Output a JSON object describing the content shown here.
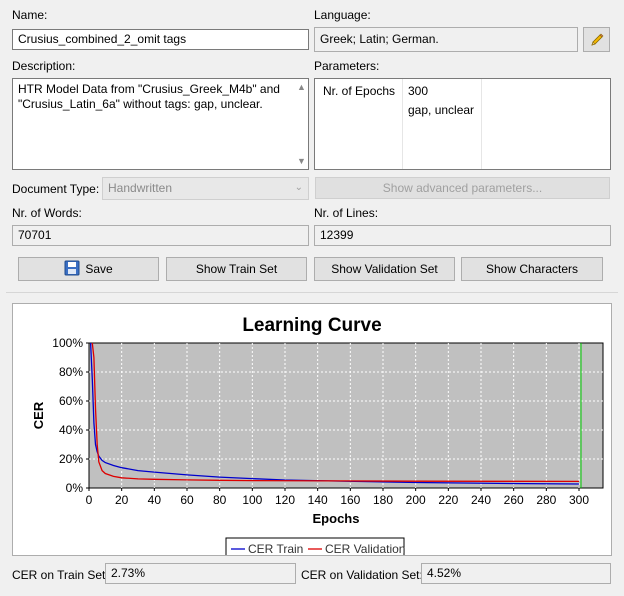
{
  "form": {
    "name_label": "Name:",
    "name_value": "Crusius_combined_2_omit tags",
    "language_label": "Language:",
    "language_value": "Greek; Latin; German.",
    "description_label": "Description:",
    "description_value": "HTR Model Data from \"Crusius_Greek_M4b\" and \"Crusius_Latin_6a\" without tags: gap, unclear.",
    "parameters_label": "Parameters:",
    "param_name": "Nr. of Epochs",
    "param_value_1": "300",
    "param_value_2": "gap, unclear",
    "doc_type_label": "Document Type:",
    "doc_type_value": "Handwritten",
    "advanced_button": "Show advanced parameters...",
    "words_label": "Nr. of Words:",
    "words_value": "70701",
    "lines_label": "Nr. of Lines:",
    "lines_value": "12399"
  },
  "buttons": {
    "save": "Save",
    "train_set": "Show Train Set",
    "validation_set": "Show Validation Set",
    "characters": "Show Characters"
  },
  "footer": {
    "cer_train_label": "CER on Train Set:",
    "cer_train_value": "2.73%",
    "cer_val_label": "CER on Validation Set:",
    "cer_val_value": "4.52%"
  },
  "colors": {
    "train": "#0000cc",
    "validation": "#dd0000",
    "marker": "#00cc00",
    "plot_bg": "#c0c0c0"
  },
  "chart_data": {
    "type": "line",
    "title": "Learning Curve",
    "xlabel": "Epochs",
    "ylabel": "CER",
    "xlim": [
      0,
      300
    ],
    "ylim": [
      0,
      100
    ],
    "x_ticks": [
      0,
      20,
      40,
      60,
      80,
      100,
      120,
      140,
      160,
      180,
      200,
      220,
      240,
      260,
      280,
      300
    ],
    "y_ticks": [
      "0%",
      "20%",
      "40%",
      "60%",
      "80%",
      "100%"
    ],
    "legend_position": "bottom-center",
    "marker_epoch": 300,
    "series": [
      {
        "name": "CER Train",
        "x": [
          1,
          2,
          3,
          4,
          5,
          6,
          8,
          10,
          15,
          20,
          30,
          40,
          60,
          80,
          100,
          120,
          150,
          200,
          250,
          300
        ],
        "values": [
          100,
          75,
          45,
          30,
          25,
          22,
          19,
          17.5,
          15.5,
          14,
          12,
          11,
          9,
          7.5,
          6.5,
          5.5,
          4.8,
          3.8,
          3.2,
          2.73
        ]
      },
      {
        "name": "CER Validation",
        "x": [
          2,
          3,
          4,
          5,
          6,
          8,
          10,
          15,
          20,
          30,
          40,
          60,
          80,
          100,
          150,
          200,
          250,
          300
        ],
        "values": [
          100,
          90,
          55,
          30,
          18,
          12,
          10,
          8,
          7,
          6.3,
          6,
          5.6,
          5.3,
          5.1,
          4.9,
          4.7,
          4.6,
          4.52
        ]
      }
    ]
  }
}
